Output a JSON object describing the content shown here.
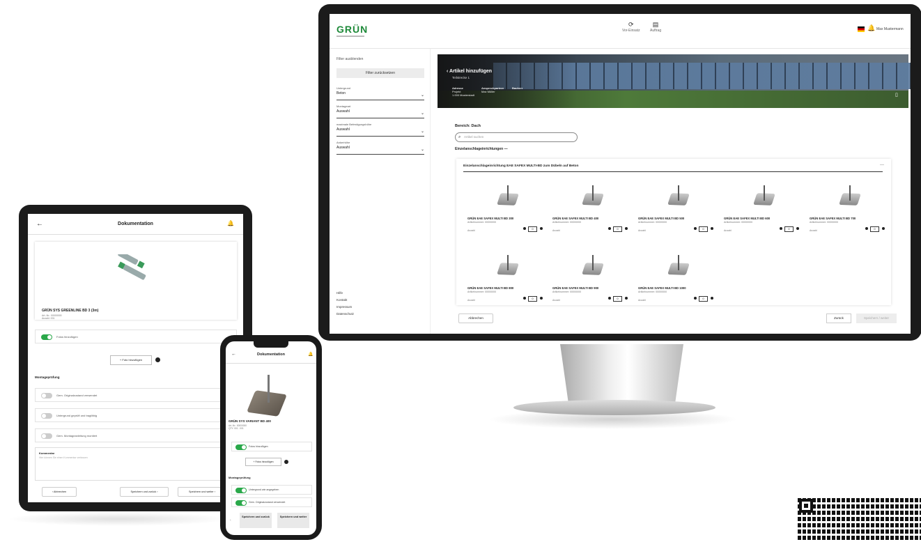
{
  "desktop": {
    "logo": "GRÜN",
    "top_nav": [
      {
        "icon": "refresh-icon",
        "glyph": "⟳",
        "label": "Vor-Einsatz"
      },
      {
        "icon": "calendar-icon",
        "glyph": "▤",
        "label": "Auftrag"
      }
    ],
    "user_name": "Max Mustermann",
    "filter_toggle": "Filter ausblenden",
    "filter_button": "Filter zurücksetzen",
    "filters": [
      {
        "label": "Untergrund",
        "value": "Beton"
      },
      {
        "label": "Montageart",
        "value": "Auswahl"
      },
      {
        "label": "maximale Befestigungshöhe",
        "value": "Auswahl"
      },
      {
        "label": "Ankerhöhe",
        "value": "Auswahl"
      }
    ],
    "side_links": [
      "Hilfe",
      "Kontakt",
      "Impressum",
      "Datenschutz"
    ],
    "hero": {
      "title": "Artikel hinzufügen",
      "subtitle": "Teilstrecke 1",
      "meta": [
        {
          "k": "Adresse",
          "v": "Projekt\n1.000 Musterstadt"
        },
        {
          "k": "Ansprechpartner",
          "v": "Max Müller"
        },
        {
          "k": "Bauherr",
          "v": ""
        }
      ]
    },
    "area_label": "Bereich: Dach",
    "search_placeholder": "Artikel suchen",
    "section_label": "Einzelanschlageinrichtungen",
    "card_title": "Einzelanschlageinrichtung EAE SAFEX MULTI-BD zum Dübeln auf Beton",
    "qty_label": "Anzahl",
    "products": [
      {
        "name": "GRÜN EAE SAFEX MULTI BD 300",
        "sku": "Artikelnummer: 00000000",
        "qty": "0"
      },
      {
        "name": "GRÜN EAE SAFEX MULTI BD 400",
        "sku": "Artikelnummer: 00000000",
        "qty": "0"
      },
      {
        "name": "GRÜN EAE SAFEX MULTI BD 500",
        "sku": "Artikelnummer: 00000000",
        "qty": "0"
      },
      {
        "name": "GRÜN EAE SAFEX MULTI BD 600",
        "sku": "Artikelnummer: 00000000",
        "qty": "0"
      },
      {
        "name": "GRÜN EAE SAFEX MULTI BD 700",
        "sku": "Artikelnummer: 00000000",
        "qty": "0"
      },
      {
        "name": "GRÜN EAE SAFEX MULTI BD 800",
        "sku": "Artikelnummer: 00000000",
        "qty": "0"
      },
      {
        "name": "GRÜN EAE SAFEX MULTI BD 900",
        "sku": "Artikelnummer: 00000000",
        "qty": "0"
      },
      {
        "name": "GRÜN EAE SAFEX MULTI BD 1000",
        "sku": "Artikelnummer: 00000000",
        "qty": "0"
      }
    ],
    "btn_cancel": "Abbrechen",
    "btn_back": "Zurück",
    "btn_next": "Speichern / weiter"
  },
  "tablet": {
    "title": "Dokumentation",
    "product_name": "GRÜN SYS GREENLINE BD 3 (3m)",
    "product_sub": "Art.-Nr.: 00000000\nAnzahl: 001",
    "toggle_photos": "Fotos hinzufügen",
    "add_photo": "+ Foto hinzufügen",
    "section": "Montageprüfung",
    "checks": [
      "Gem. Originalzustand verwendet",
      "Untergrund geprüft und tragfähig",
      "Gem. Montageanleitung montiert"
    ],
    "comment_label": "Kommentar",
    "comment_placeholder": "Hier können Sie einen Kommentar verfassen",
    "btn_back": "‹ Abbrechen",
    "btn_save_back": "Speichern und zurück ›",
    "btn_save_next": "Speichern und weiter ›"
  },
  "phone": {
    "title": "Dokumentation",
    "product_name": "GRÜN SYS VARIANT BD 400",
    "product_sub": "Art.-Nr.: 00000000\nQTY: 001 - 001",
    "toggle_photos": "Fotos hinzufügen",
    "add_photo": "+ Fotos hinzufügen",
    "section": "Montageprüfung",
    "checks": [
      "Untergrund wie angegeben",
      "Gem. Originalzustand verwendet"
    ],
    "btn_save_back": "Speichern und zurück",
    "btn_save_next": "Speichern und weiter"
  }
}
